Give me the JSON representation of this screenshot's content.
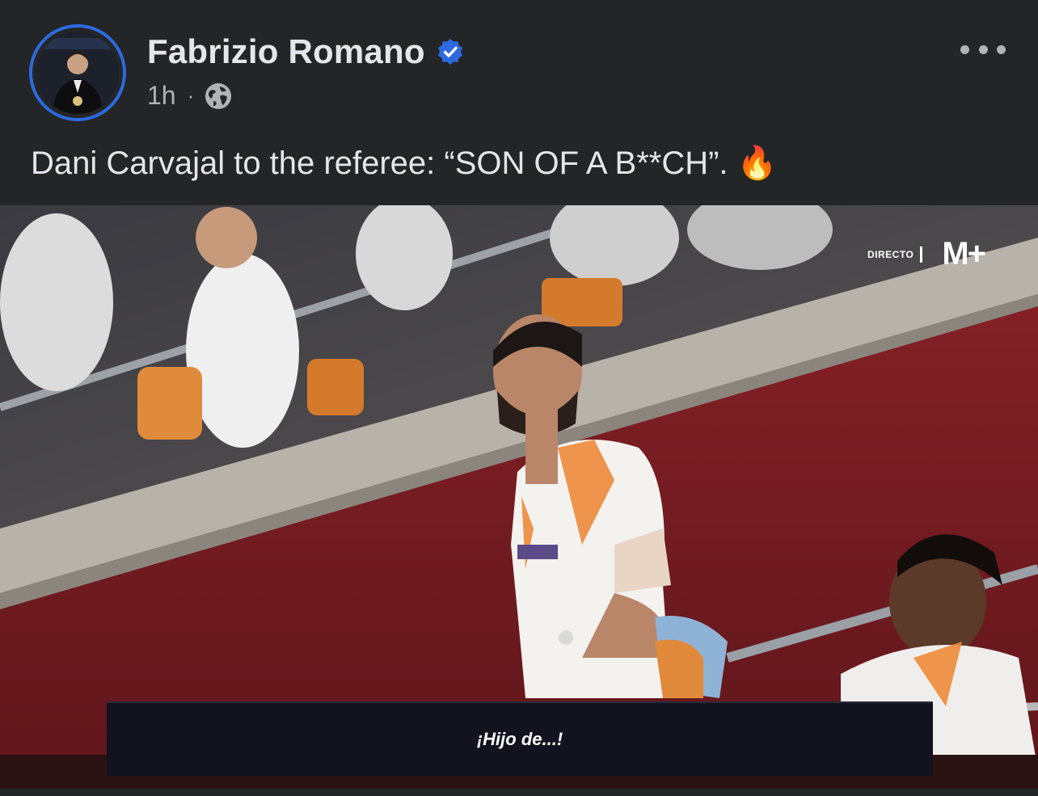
{
  "post": {
    "author": "Fabrizio Romano",
    "verified": true,
    "time": "1h",
    "separator": "·",
    "privacy_icon": "globe-icon",
    "more_icon": "ellipsis-icon",
    "caption": "Dani Carvajal to the referee: “SON OF A B**CH”. 🔥"
  },
  "media": {
    "broadcast_live": "DIRECTO",
    "broadcast_brand": "M+",
    "subtitle": "¡Hijo de...!"
  },
  "colors": {
    "background": "#242526",
    "accent": "#2d6ae0",
    "text_primary": "#e4e6eb",
    "text_secondary": "#b0b3b8",
    "stand_red": "#7a1c22"
  }
}
